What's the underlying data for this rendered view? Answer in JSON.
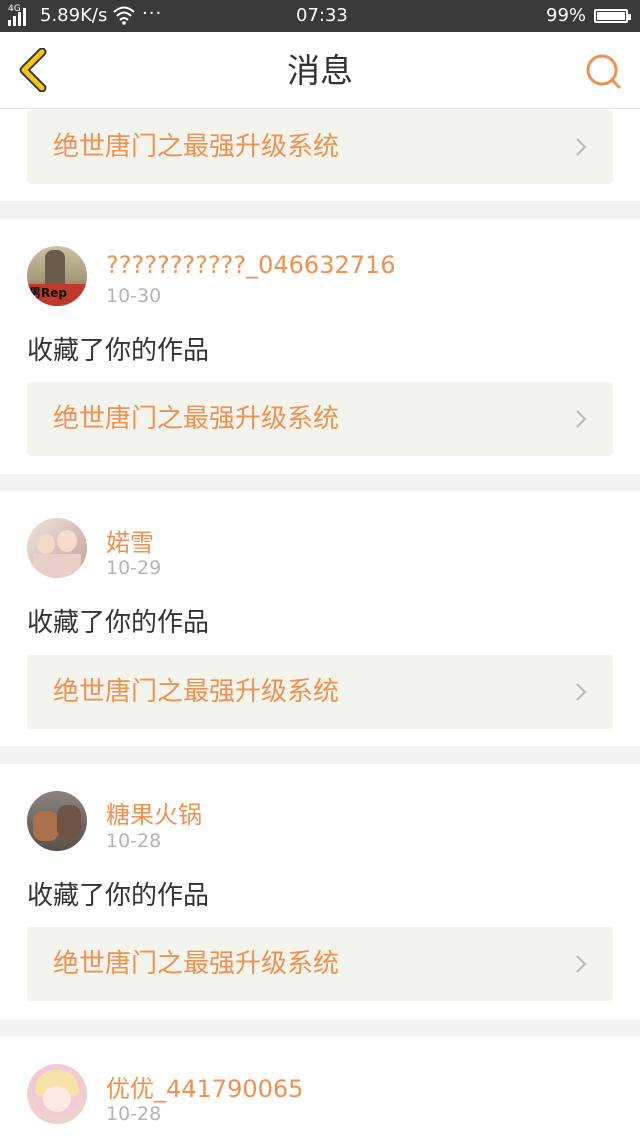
{
  "status_bar": {
    "network": "4G",
    "speed": "5.89K/s",
    "more": "···",
    "time": "07:33",
    "battery": "99%"
  },
  "nav": {
    "title": "消息",
    "back_icon": "chevron-left-icon",
    "search_icon": "search-icon"
  },
  "messages": [
    {
      "work_title": "绝世唐门之最强升级系统"
    },
    {
      "user": "???????????_046632716",
      "date": "10-30",
      "action": "收藏了你的作品",
      "work_title": "绝世唐门之最强升级系统",
      "avatar_text": "男Rep"
    },
    {
      "user": "婼雪",
      "date": "10-29",
      "action": "收藏了你的作品",
      "work_title": "绝世唐门之最强升级系统"
    },
    {
      "user": "糖果火锅",
      "date": "10-28",
      "action": "收藏了你的作品",
      "work_title": "绝世唐门之最强升级系统"
    },
    {
      "user": "优优_441790065",
      "date": "10-28"
    }
  ],
  "colors": {
    "accent": "#f0914f",
    "back_icon": "#f5c61a",
    "status_bar_bg": "#3a3a3a",
    "work_bg": "#f4f4ee"
  }
}
